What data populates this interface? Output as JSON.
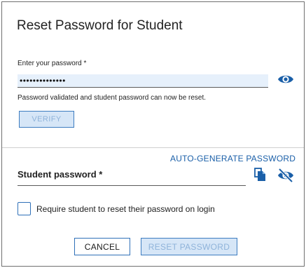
{
  "dialog": {
    "title": "Reset Password for Student"
  },
  "teacher_password": {
    "label": "Enter your password *",
    "value": "••••••••••••••",
    "toggle_icon": "eye-icon",
    "status_message": "Password validated and student password can now be reset.",
    "verify_label": "VERIFY"
  },
  "student_password": {
    "autogen_label": "AUTO-GENERATE PASSWORD",
    "label": "Student password *",
    "copy_icon": "copy-icon",
    "visibility_icon": "eye-off-icon"
  },
  "require_reset": {
    "label": "Require student to reset their password on login",
    "checked": false
  },
  "footer": {
    "cancel_label": "CANCEL",
    "reset_label": "RESET PASSWORD"
  },
  "colors": {
    "accent": "#1a5fa8",
    "disabled_button_bg": "#d6e6f7",
    "disabled_button_text": "#8fb3da",
    "field_bg": "#e6f0fb"
  }
}
